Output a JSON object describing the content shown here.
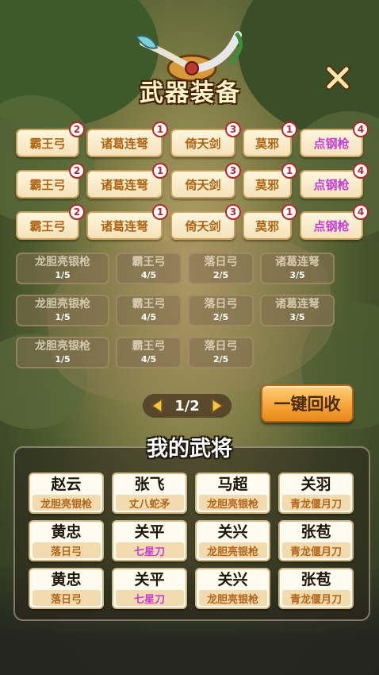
{
  "title": "武器装备",
  "equip_rows": [
    [
      {
        "name": "霸王弓",
        "level": "2",
        "color": "#b06514"
      },
      {
        "name": "诸葛连弩",
        "level": "1",
        "color": "#b06514"
      },
      {
        "name": "倚天剑",
        "level": "3",
        "color": "#b06514"
      },
      {
        "name": "莫邪",
        "level": "1",
        "color": "#b06514"
      },
      {
        "name": "点钢枪",
        "level": "4",
        "color": "#c63cd6"
      }
    ],
    [
      {
        "name": "霸王弓",
        "level": "2",
        "color": "#b06514"
      },
      {
        "name": "诸葛连弩",
        "level": "1",
        "color": "#b06514"
      },
      {
        "name": "倚天剑",
        "level": "3",
        "color": "#b06514"
      },
      {
        "name": "莫邪",
        "level": "1",
        "color": "#b06514"
      },
      {
        "name": "点钢枪",
        "level": "4",
        "color": "#c63cd6"
      }
    ],
    [
      {
        "name": "霸王弓",
        "level": "2",
        "color": "#b06514"
      },
      {
        "name": "诸葛连弩",
        "level": "1",
        "color": "#b06514"
      },
      {
        "name": "倚天剑",
        "level": "3",
        "color": "#b06514"
      },
      {
        "name": "莫邪",
        "level": "1",
        "color": "#b06514"
      },
      {
        "name": "点钢枪",
        "level": "4",
        "color": "#c63cd6"
      }
    ]
  ],
  "inventory_rows": [
    [
      {
        "name": "龙胆亮银枪",
        "count": "1/5"
      },
      {
        "name": "霸王弓",
        "count": "4/5"
      },
      {
        "name": "落日弓",
        "count": "2/5"
      },
      {
        "name": "诸葛连弩",
        "count": "3/5"
      }
    ],
    [
      {
        "name": "龙胆亮银枪",
        "count": "1/5"
      },
      {
        "name": "霸王弓",
        "count": "4/5"
      },
      {
        "name": "落日弓",
        "count": "2/5"
      },
      {
        "name": "诸葛连弩",
        "count": "3/5"
      }
    ],
    [
      {
        "name": "龙胆亮银枪",
        "count": "1/5"
      },
      {
        "name": "霸王弓",
        "count": "4/5"
      },
      {
        "name": "落日弓",
        "count": "2/5"
      }
    ]
  ],
  "pager": {
    "text": "1/2"
  },
  "recycle_label": "一键回收",
  "generals_title": "我的武将",
  "generals": [
    [
      {
        "name": "赵云",
        "weapon": "龙胆亮银枪",
        "color": "#b4651a"
      },
      {
        "name": "张飞",
        "weapon": "丈八蛇矛",
        "color": "#b4651a"
      },
      {
        "name": "马超",
        "weapon": "龙胆亮银枪",
        "color": "#b4651a"
      },
      {
        "name": "关羽",
        "weapon": "青龙偃月刀",
        "color": "#b4651a"
      }
    ],
    [
      {
        "name": "黄忠",
        "weapon": "落日弓",
        "color": "#b4651a"
      },
      {
        "name": "关平",
        "weapon": "七星刀",
        "color": "#c63cd6"
      },
      {
        "name": "关兴",
        "weapon": "龙胆亮银枪",
        "color": "#b4651a"
      },
      {
        "name": "张苞",
        "weapon": "青龙偃月刀",
        "color": "#b4651a"
      }
    ],
    [
      {
        "name": "黄忠",
        "weapon": "落日弓",
        "color": "#b4651a"
      },
      {
        "name": "关平",
        "weapon": "七星刀",
        "color": "#c63cd6"
      },
      {
        "name": "关兴",
        "weapon": "龙胆亮银枪",
        "color": "#b4651a"
      },
      {
        "name": "张苞",
        "weapon": "青龙偃月刀",
        "color": "#b4651a"
      }
    ]
  ]
}
